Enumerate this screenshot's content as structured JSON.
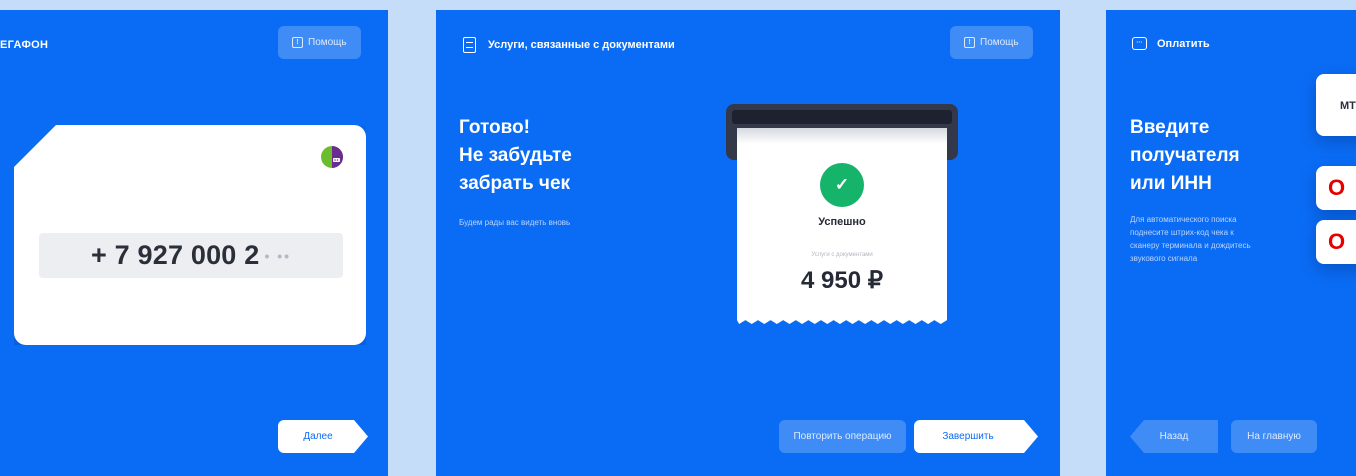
{
  "panel1": {
    "brand": "ЕГАФОН",
    "help_label": "Помощь",
    "phone": "+ 7 927 000 2",
    "phone_masked": "• ••",
    "next_label": "Далее"
  },
  "panel2": {
    "title": "Услуги, связанные с документами",
    "help_label": "Помощь",
    "heading": [
      "Готово!",
      "Не забудьте",
      "забрать чек"
    ],
    "subtext": "Будем рады вас видеть вновь",
    "receipt": {
      "status": "Успешно",
      "service": "Услуги с документами",
      "amount": "4 950 ₽"
    },
    "repeat_label": "Повторить операцию",
    "finish_label": "Завершить"
  },
  "panel3": {
    "title": "Оплатить",
    "heading": [
      "Введите",
      "получателя",
      "или ИНН"
    ],
    "hint": [
      "Для автоматического поиска",
      "поднесите штрих-код чека к",
      "сканеру терминала и дождитесь",
      "звукового сигнала"
    ],
    "operator_1": "МТ",
    "operator_2_logo": "O",
    "operator_3_logo": "O",
    "back_label": "Назад",
    "home_label": "На главную"
  },
  "colors": {
    "brand_blue": "#0a6cf5",
    "background": "#c5ddf8",
    "success_green": "#16b36a",
    "vodafone_red": "#e60000"
  }
}
